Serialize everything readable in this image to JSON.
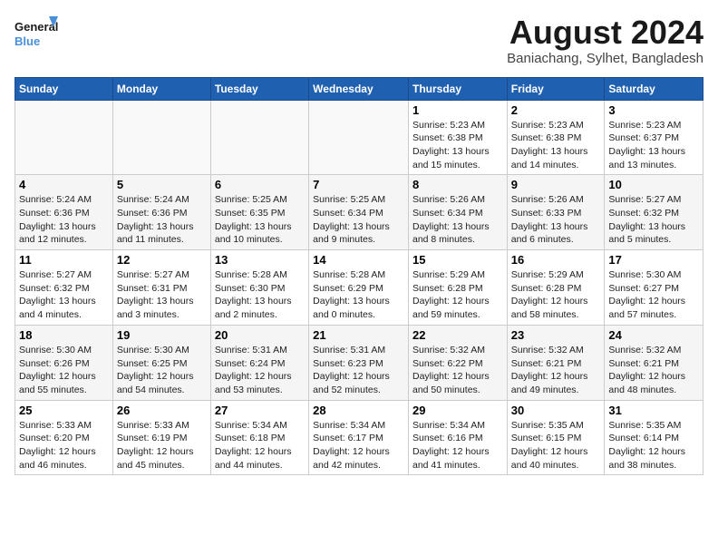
{
  "logo": {
    "line1": "General",
    "line2": "Blue"
  },
  "title": "August 2024",
  "location": "Baniachang, Sylhet, Bangladesh",
  "days_of_week": [
    "Sunday",
    "Monday",
    "Tuesday",
    "Wednesday",
    "Thursday",
    "Friday",
    "Saturday"
  ],
  "weeks": [
    [
      {
        "day": "",
        "content": ""
      },
      {
        "day": "",
        "content": ""
      },
      {
        "day": "",
        "content": ""
      },
      {
        "day": "",
        "content": ""
      },
      {
        "day": "1",
        "content": "Sunrise: 5:23 AM\nSunset: 6:38 PM\nDaylight: 13 hours\nand 15 minutes."
      },
      {
        "day": "2",
        "content": "Sunrise: 5:23 AM\nSunset: 6:38 PM\nDaylight: 13 hours\nand 14 minutes."
      },
      {
        "day": "3",
        "content": "Sunrise: 5:23 AM\nSunset: 6:37 PM\nDaylight: 13 hours\nand 13 minutes."
      }
    ],
    [
      {
        "day": "4",
        "content": "Sunrise: 5:24 AM\nSunset: 6:36 PM\nDaylight: 13 hours\nand 12 minutes."
      },
      {
        "day": "5",
        "content": "Sunrise: 5:24 AM\nSunset: 6:36 PM\nDaylight: 13 hours\nand 11 minutes."
      },
      {
        "day": "6",
        "content": "Sunrise: 5:25 AM\nSunset: 6:35 PM\nDaylight: 13 hours\nand 10 minutes."
      },
      {
        "day": "7",
        "content": "Sunrise: 5:25 AM\nSunset: 6:34 PM\nDaylight: 13 hours\nand 9 minutes."
      },
      {
        "day": "8",
        "content": "Sunrise: 5:26 AM\nSunset: 6:34 PM\nDaylight: 13 hours\nand 8 minutes."
      },
      {
        "day": "9",
        "content": "Sunrise: 5:26 AM\nSunset: 6:33 PM\nDaylight: 13 hours\nand 6 minutes."
      },
      {
        "day": "10",
        "content": "Sunrise: 5:27 AM\nSunset: 6:32 PM\nDaylight: 13 hours\nand 5 minutes."
      }
    ],
    [
      {
        "day": "11",
        "content": "Sunrise: 5:27 AM\nSunset: 6:32 PM\nDaylight: 13 hours\nand 4 minutes."
      },
      {
        "day": "12",
        "content": "Sunrise: 5:27 AM\nSunset: 6:31 PM\nDaylight: 13 hours\nand 3 minutes."
      },
      {
        "day": "13",
        "content": "Sunrise: 5:28 AM\nSunset: 6:30 PM\nDaylight: 13 hours\nand 2 minutes."
      },
      {
        "day": "14",
        "content": "Sunrise: 5:28 AM\nSunset: 6:29 PM\nDaylight: 13 hours\nand 0 minutes."
      },
      {
        "day": "15",
        "content": "Sunrise: 5:29 AM\nSunset: 6:28 PM\nDaylight: 12 hours\nand 59 minutes."
      },
      {
        "day": "16",
        "content": "Sunrise: 5:29 AM\nSunset: 6:28 PM\nDaylight: 12 hours\nand 58 minutes."
      },
      {
        "day": "17",
        "content": "Sunrise: 5:30 AM\nSunset: 6:27 PM\nDaylight: 12 hours\nand 57 minutes."
      }
    ],
    [
      {
        "day": "18",
        "content": "Sunrise: 5:30 AM\nSunset: 6:26 PM\nDaylight: 12 hours\nand 55 minutes."
      },
      {
        "day": "19",
        "content": "Sunrise: 5:30 AM\nSunset: 6:25 PM\nDaylight: 12 hours\nand 54 minutes."
      },
      {
        "day": "20",
        "content": "Sunrise: 5:31 AM\nSunset: 6:24 PM\nDaylight: 12 hours\nand 53 minutes."
      },
      {
        "day": "21",
        "content": "Sunrise: 5:31 AM\nSunset: 6:23 PM\nDaylight: 12 hours\nand 52 minutes."
      },
      {
        "day": "22",
        "content": "Sunrise: 5:32 AM\nSunset: 6:22 PM\nDaylight: 12 hours\nand 50 minutes."
      },
      {
        "day": "23",
        "content": "Sunrise: 5:32 AM\nSunset: 6:21 PM\nDaylight: 12 hours\nand 49 minutes."
      },
      {
        "day": "24",
        "content": "Sunrise: 5:32 AM\nSunset: 6:21 PM\nDaylight: 12 hours\nand 48 minutes."
      }
    ],
    [
      {
        "day": "25",
        "content": "Sunrise: 5:33 AM\nSunset: 6:20 PM\nDaylight: 12 hours\nand 46 minutes."
      },
      {
        "day": "26",
        "content": "Sunrise: 5:33 AM\nSunset: 6:19 PM\nDaylight: 12 hours\nand 45 minutes."
      },
      {
        "day": "27",
        "content": "Sunrise: 5:34 AM\nSunset: 6:18 PM\nDaylight: 12 hours\nand 44 minutes."
      },
      {
        "day": "28",
        "content": "Sunrise: 5:34 AM\nSunset: 6:17 PM\nDaylight: 12 hours\nand 42 minutes."
      },
      {
        "day": "29",
        "content": "Sunrise: 5:34 AM\nSunset: 6:16 PM\nDaylight: 12 hours\nand 41 minutes."
      },
      {
        "day": "30",
        "content": "Sunrise: 5:35 AM\nSunset: 6:15 PM\nDaylight: 12 hours\nand 40 minutes."
      },
      {
        "day": "31",
        "content": "Sunrise: 5:35 AM\nSunset: 6:14 PM\nDaylight: 12 hours\nand 38 minutes."
      }
    ]
  ]
}
